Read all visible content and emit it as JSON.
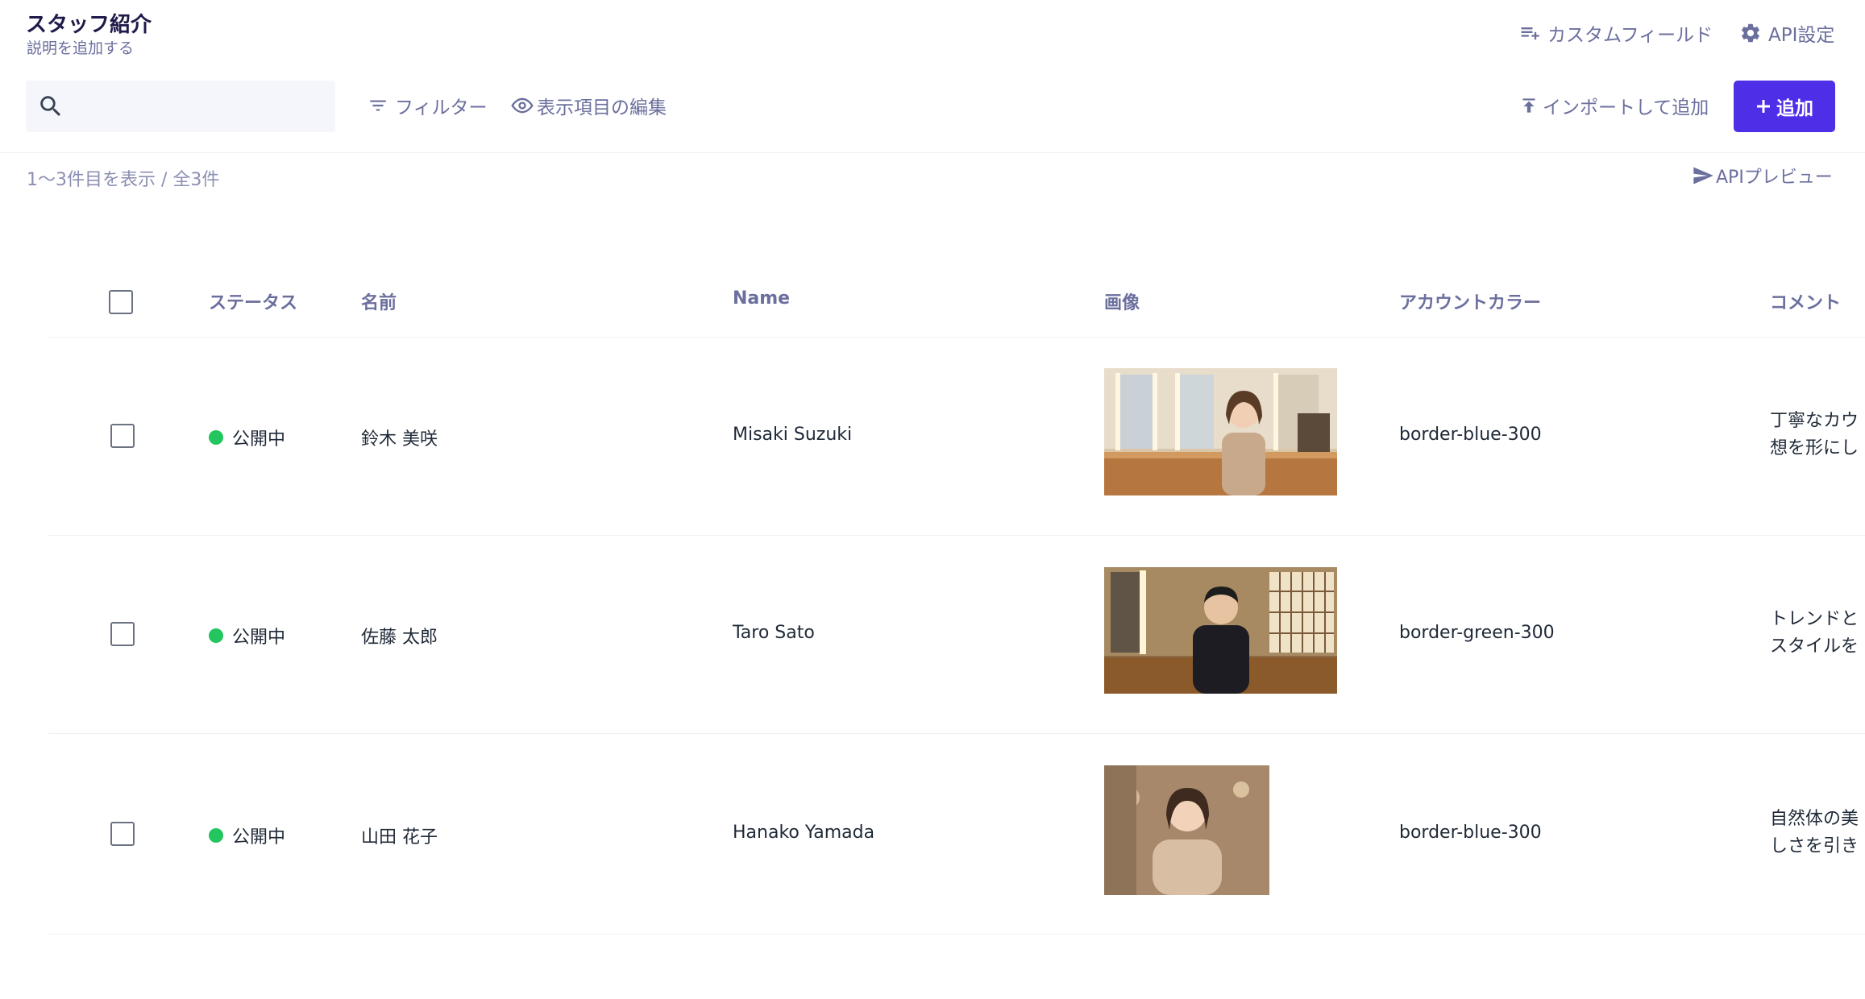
{
  "header": {
    "title": "スタッフ紹介",
    "subtitle": "説明を追加する",
    "custom_field_label": "カスタムフィールド",
    "api_settings_label": "API設定"
  },
  "toolbar": {
    "search_placeholder": "",
    "filter_label": "フィルター",
    "edit_columns_label": "表示項目の編集",
    "import_label": "インポートして追加",
    "add_label": "追加"
  },
  "summary": {
    "count_text": "1〜3件目を表示 / 全3件",
    "api_preview_label": "APIプレビュー"
  },
  "table": {
    "columns": [
      "ステータス",
      "名前",
      "Name",
      "画像",
      "アカウントカラー",
      "コメント"
    ],
    "rows": [
      {
        "status": "公開中",
        "name_ja": "鈴木 美咲",
        "name_en": "Misaki Suzuki",
        "image_icon": "stylist-photo-woman-salon",
        "account_color": "border-blue-300",
        "comment": [
          "丁寧なカウ",
          "想を形にし"
        ]
      },
      {
        "status": "公開中",
        "name_ja": "佐藤 太郎",
        "name_en": "Taro Sato",
        "image_icon": "stylist-photo-man-salon",
        "account_color": "border-green-300",
        "comment": [
          "トレンドと",
          "スタイルを"
        ]
      },
      {
        "status": "公開中",
        "name_ja": "山田 花子",
        "name_en": "Hanako Yamada",
        "image_icon": "stylist-photo-woman-portrait",
        "account_color": "border-blue-300",
        "comment": [
          "自然体の美",
          "しさを引き"
        ]
      }
    ]
  },
  "colors": {
    "accent": "#4f2ee8",
    "status_published": "#22c55e",
    "muted_text": "#6b6f9e"
  }
}
